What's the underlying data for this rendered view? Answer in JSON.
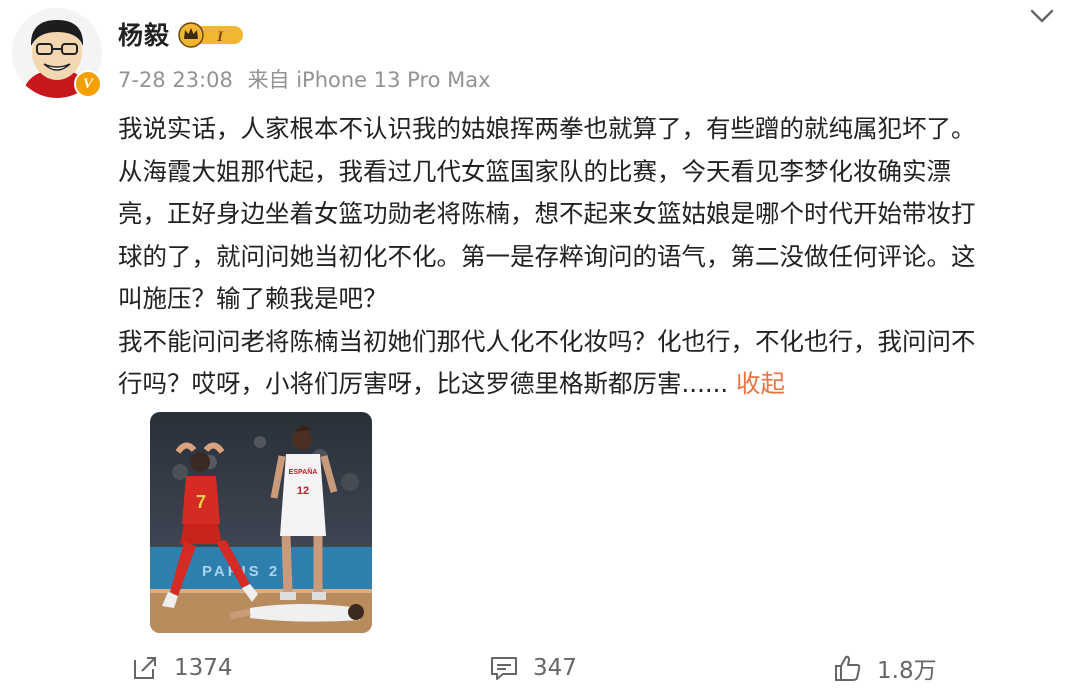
{
  "post": {
    "author": "杨毅",
    "vip_level": "I",
    "verified_mark": "V",
    "time": "7-28 23:08",
    "source": "来自 iPhone 13 Pro Max",
    "body_lines": [
      "我说实话，人家根本不认识我的姑娘挥两拳也就算了，有些蹭的就纯属犯坏了。",
      "从海霞大姐那代起，我看过几代女篮国家队的比赛，今天看见李梦化妆确实漂",
      "亮，正好身边坐着女篮功勋老将陈楠，想不起来女篮姑娘是哪个时代开始带妆打",
      "球的了，就问问她当初化不化。第一是存粹询问的语气，第二没做任何评论。这",
      "叫施压？输了赖我是吧？",
      "我不能问问老将陈楠当初她们那代人化不化妆吗？化也行，不化也行，我问问不",
      "行吗？哎呀，小将们厉害呀，比这罗德里格斯都厉害......"
    ],
    "collapse_label": "收起",
    "photo_text": {
      "jersey_china": "7",
      "jersey_spain": "12",
      "spain_label": "ESPAÑA",
      "banner": "PARIS 2"
    }
  },
  "actions": {
    "repost_count": "1374",
    "comment_count": "347",
    "like_count": "1.8万"
  },
  "colors": {
    "accent": "#eb7340",
    "muted": "#939393",
    "vip_gold": "#f2b632",
    "verified": "#f6a000"
  },
  "icons": {
    "expand": "chevron-down-icon",
    "repost": "repost-icon",
    "comment": "comment-icon",
    "like": "thumbs-up-icon"
  }
}
